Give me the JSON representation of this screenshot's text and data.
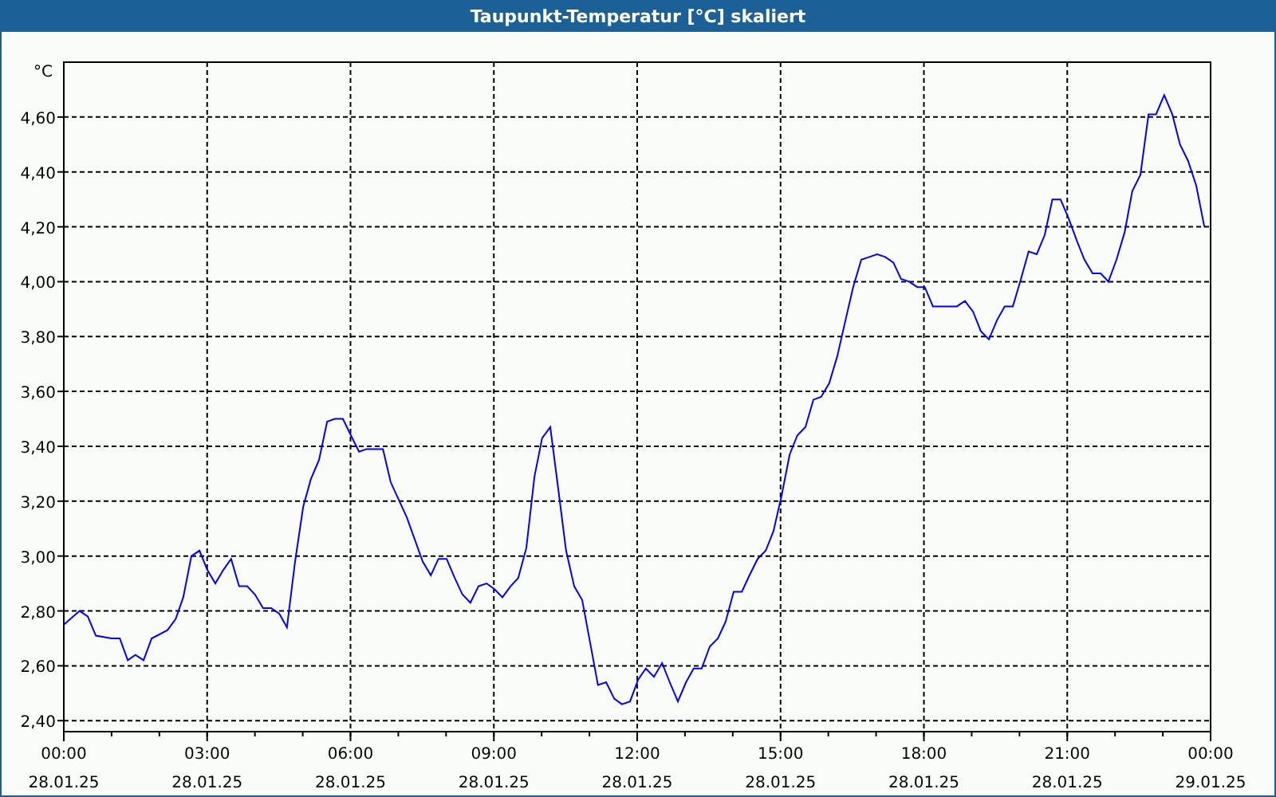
{
  "window": {
    "title": "Taupunkt-Temperatur [°C] skaliert"
  },
  "chart": {
    "chart_data": {
      "type": "line",
      "ylabel": "°C",
      "grid": true,
      "xlim": [
        0,
        24
      ],
      "ylim": [
        2.36,
        4.8
      ],
      "xticks": [
        {
          "value": 0,
          "label": "00:00"
        },
        {
          "value": 3,
          "label": "03:00"
        },
        {
          "value": 6,
          "label": "06:00"
        },
        {
          "value": 9,
          "label": "09:00"
        },
        {
          "value": 12,
          "label": "12:00"
        },
        {
          "value": 15,
          "label": "15:00"
        },
        {
          "value": 18,
          "label": "18:00"
        },
        {
          "value": 21,
          "label": "21:00"
        },
        {
          "value": 24,
          "label": "00:00"
        }
      ],
      "yticks": [
        {
          "value": 2.4,
          "label": "2,40"
        },
        {
          "value": 2.6,
          "label": "2,60"
        },
        {
          "value": 2.8,
          "label": "2,80"
        },
        {
          "value": 3.0,
          "label": "3,00"
        },
        {
          "value": 3.2,
          "label": "3,20"
        },
        {
          "value": 3.4,
          "label": "3,40"
        },
        {
          "value": 3.6,
          "label": "3,60"
        },
        {
          "value": 3.8,
          "label": "3,80"
        },
        {
          "value": 4.0,
          "label": "4,00"
        },
        {
          "value": 4.2,
          "label": "4,20"
        },
        {
          "value": 4.4,
          "label": "4,40"
        },
        {
          "value": 4.6,
          "label": "4,60"
        }
      ],
      "x": [
        0,
        0.33,
        0.5,
        0.67,
        1.0,
        1.17,
        1.34,
        1.5,
        1.67,
        1.84,
        2.17,
        2.34,
        2.5,
        2.67,
        2.84,
        3.0,
        3.17,
        3.34,
        3.5,
        3.67,
        3.84,
        4.0,
        4.17,
        4.34,
        4.51,
        4.67,
        4.84,
        5.01,
        5.17,
        5.34,
        5.51,
        5.67,
        5.84,
        6.01,
        6.18,
        6.34,
        6.51,
        6.68,
        6.84,
        7.18,
        7.51,
        7.68,
        7.84,
        8.01,
        8.18,
        8.34,
        8.51,
        8.68,
        8.85,
        9.01,
        9.18,
        9.35,
        9.51,
        9.68,
        9.85,
        10.01,
        10.18,
        10.35,
        10.51,
        10.68,
        10.85,
        11.01,
        11.18,
        11.35,
        11.52,
        11.68,
        11.85,
        12.02,
        12.18,
        12.35,
        12.52,
        12.68,
        12.85,
        13.02,
        13.18,
        13.35,
        13.52,
        13.69,
        13.85,
        14.02,
        14.19,
        14.35,
        14.52,
        14.69,
        14.85,
        15.02,
        15.19,
        15.35,
        15.52,
        15.69,
        15.85,
        16.02,
        16.19,
        16.36,
        16.52,
        16.69,
        16.86,
        17.02,
        17.19,
        17.36,
        17.52,
        17.69,
        17.86,
        18.02,
        18.19,
        18.36,
        18.52,
        18.69,
        18.86,
        19.03,
        19.19,
        19.36,
        19.53,
        19.69,
        19.86,
        20.03,
        20.19,
        20.36,
        20.53,
        20.69,
        20.86,
        21.03,
        21.2,
        21.36,
        21.53,
        21.7,
        21.86,
        22.03,
        22.2,
        22.36,
        22.53,
        22.7,
        22.86,
        23.03,
        23.2,
        23.36,
        23.53,
        23.7,
        23.87
      ],
      "series": [
        {
          "color": "#0000ff",
          "values": [
            2.75,
            2.8,
            2.78,
            2.71,
            2.7,
            2.7,
            2.62,
            2.64,
            2.62,
            2.7,
            2.73,
            2.77,
            2.85,
            3.0,
            3.02,
            2.95,
            2.9,
            2.95,
            2.99,
            2.89,
            2.89,
            2.86,
            2.81,
            2.81,
            2.79,
            2.74,
            2.98,
            3.18,
            3.28,
            3.35,
            3.49,
            3.5,
            3.5,
            3.44,
            3.38,
            3.39,
            3.39,
            3.39,
            3.27,
            3.14,
            2.98,
            2.93,
            2.99,
            2.99,
            2.92,
            2.86,
            2.83,
            2.89,
            2.9,
            2.88,
            2.85,
            2.89,
            2.92,
            3.03,
            3.29,
            3.43,
            3.47,
            3.24,
            3.02,
            2.89,
            2.84,
            2.69,
            2.53,
            2.54,
            2.48,
            2.46,
            2.47,
            2.55,
            2.59,
            2.56,
            2.61,
            2.54,
            2.47,
            2.54,
            2.59,
            2.59,
            2.67,
            2.7,
            2.76,
            2.87,
            2.87,
            2.93,
            2.99,
            3.02,
            3.09,
            3.22,
            3.37,
            3.44,
            3.47,
            3.57,
            3.58,
            3.63,
            3.73,
            3.86,
            3.98,
            4.08,
            4.09,
            4.1,
            4.09,
            4.07,
            4.01,
            4.0,
            3.98,
            3.98,
            3.91,
            3.91,
            3.91,
            3.91,
            3.93,
            3.89,
            3.82,
            3.79,
            3.86,
            3.91,
            3.91,
            4.01,
            4.11,
            4.1,
            4.17,
            4.3,
            4.3,
            4.23,
            4.15,
            4.08,
            4.03,
            4.03,
            4.0,
            4.08,
            4.18,
            4.33,
            4.39,
            4.61,
            4.61,
            4.68,
            4.61,
            4.5,
            4.44,
            4.35,
            4.2
          ]
        }
      ]
    },
    "x_dates": [
      "28.01.25",
      "28.01.25",
      "28.01.25",
      "28.01.25",
      "28.01.25",
      "28.01.25",
      "28.01.25",
      "28.01.25",
      "29.01.25"
    ]
  }
}
